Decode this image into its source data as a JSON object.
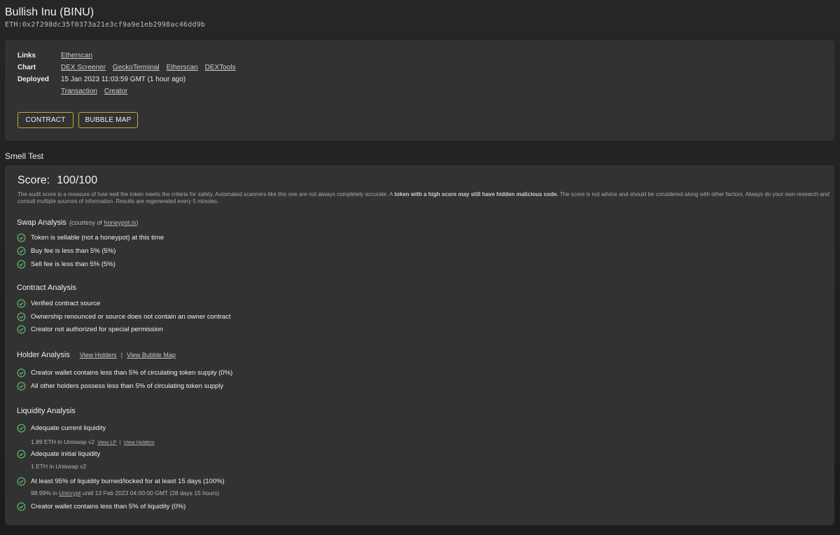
{
  "token": {
    "title": "Bullish Inu (BINU)",
    "address": "ETH:0x2f298dc35f0373a21e3cf9a9e1eb2998ac46dd9b"
  },
  "info": {
    "links_label": "Links",
    "links": [
      "Etherscan"
    ],
    "chart_label": "Chart",
    "chart_links": [
      "DEX Screener",
      "GeckoTerminal",
      "Etherscan",
      "DEXTools"
    ],
    "deployed_label": "Deployed",
    "deployed_value": "15 Jan 2023 11:03:59 GMT (1 hour ago)",
    "deployed_links": [
      "Transaction",
      "Creator"
    ],
    "contract_button": "CONTRACT",
    "bubble_button": "BUBBLE MAP"
  },
  "smell": {
    "heading": "Smell Test",
    "score_label": "Score:",
    "score_value": "100/100",
    "disclaimer_pre": "The audit score is a measure of how well the token meets the criteria for safety.  Automated scanners like this one are not always completely accurate.  A ",
    "disclaimer_bold": "token with a high score may still have hidden malicious code.",
    "disclaimer_post": " The score is not advice and should be considered along with other factors. Always do your own research and consult multiple sources of information.  Results are regenerated every 5 minutes."
  },
  "swap": {
    "title": "Swap Analysis",
    "courtesy_pre": "(courtesy of ",
    "courtesy_link": "honeypot.is",
    "courtesy_post": ")",
    "items": [
      "Token is sellable (not a honeypot) at this time",
      "Buy fee is less than 5% (5%)",
      "Sell fee is less than 5% (5%)"
    ]
  },
  "contract": {
    "title": "Contract Analysis",
    "items": [
      "Verified contract source",
      "Ownership renounced or source does not contain an owner contract",
      "Creator not authorized for special permission"
    ]
  },
  "holder": {
    "title": "Holder Analysis",
    "view_holders": "View Holders",
    "separator": "|",
    "view_bubble": "View Bubble Map",
    "items": [
      "Creator wallet contains less than 5% of circulating token supply (0%)",
      "All other holders possess less than 5% of circulating token supply"
    ]
  },
  "liquidity": {
    "title": "Liquidity Analysis",
    "item1": "Adequate current liquidity",
    "item1_sub": "1.89 ETH in Uniswap v2",
    "item1_view_lp": "View LP",
    "item1_sep": "|",
    "item1_view_holders": "View Holders",
    "item2": "Adequate initial liquidity",
    "item2_sub": "1 ETH in Uniswap v2",
    "item3": "At least 95% of liquidity burned/locked for at least 15 days (100%)",
    "item3_sub_pre": "98.99% in ",
    "item3_sub_link": "Unicrypt",
    "item3_sub_post": " until 13 Feb 2023 04:00:00 GMT (28 days 15 hours)",
    "item4": "Creator wallet contains less than 5% of liquidity (0%)"
  },
  "colors": {
    "accent_border": "#c9a82c",
    "check_green": "#5fbf6b",
    "panel_bg": "#323232"
  },
  "icons": {
    "check": "check-circle-icon"
  }
}
